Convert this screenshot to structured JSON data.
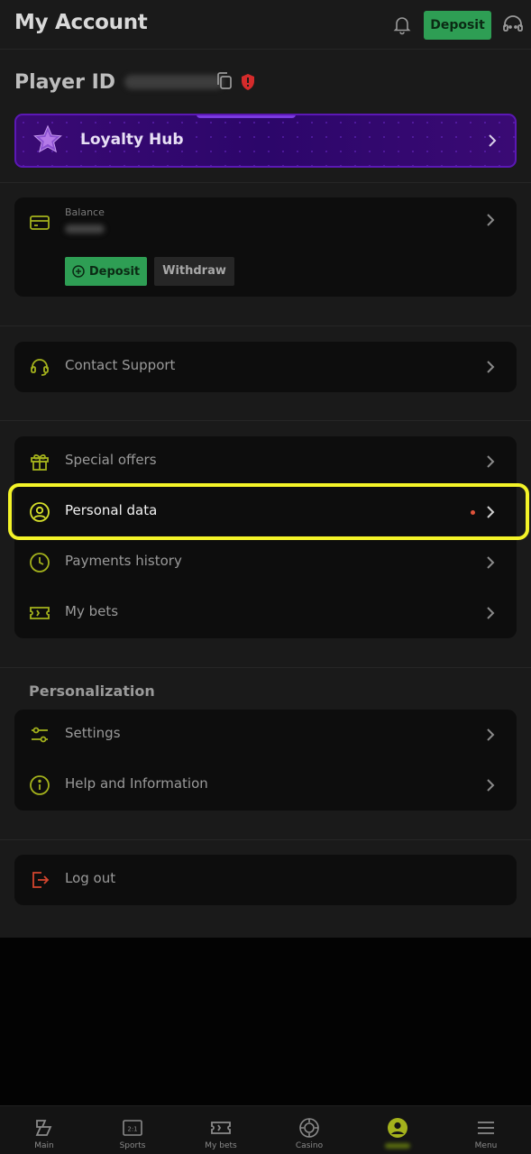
{
  "header": {
    "title": "My Account",
    "deposit_label": "Deposit"
  },
  "player": {
    "label": "Player ID"
  },
  "loyalty": {
    "label": "Loyalty Hub"
  },
  "balance": {
    "label": "Balance",
    "deposit_label": "Deposit",
    "withdraw_label": "Withdraw"
  },
  "support": {
    "label": "Contact Support"
  },
  "menu": {
    "items": [
      {
        "label": "Special offers",
        "icon": "gift-icon"
      },
      {
        "label": "Personal data",
        "icon": "user-circle-icon"
      },
      {
        "label": "Payments history",
        "icon": "clock-icon"
      },
      {
        "label": "My bets",
        "icon": "ticket-icon"
      }
    ]
  },
  "personalization": {
    "title": "Personalization",
    "items": [
      {
        "label": "Settings",
        "icon": "sliders-icon"
      },
      {
        "label": "Help and Information",
        "icon": "info-icon"
      }
    ]
  },
  "logout": {
    "label": "Log out"
  },
  "tabbar": {
    "items": [
      {
        "label": "Main",
        "icon": "home-icon"
      },
      {
        "label": "Sports",
        "icon": "scoreboard-icon"
      },
      {
        "label": "My bets",
        "icon": "ticket-icon"
      },
      {
        "label": "Casino",
        "icon": "chip-icon"
      },
      {
        "label": "",
        "icon": "account-icon",
        "active": true
      },
      {
        "label": "Menu",
        "icon": "hamburger-icon"
      }
    ]
  },
  "colors": {
    "accent_green": "#2e9e54",
    "icon_olive": "#a4b21c",
    "highlight_yellow": "#f3f328",
    "loyalty_purple": "#3a0a74",
    "alert_red": "#e0533a"
  }
}
